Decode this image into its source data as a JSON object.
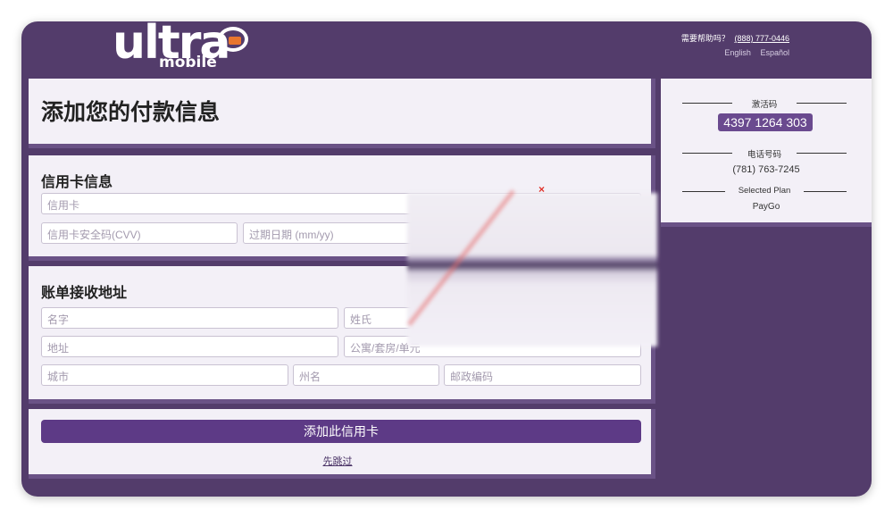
{
  "header": {
    "logo_word": "ultra",
    "logo_sub": "mobile",
    "help_label": "需要帮助吗？",
    "help_phone": "(888) 777-0446",
    "lang_en": "English",
    "lang_es": "Español"
  },
  "title_panel": {
    "title": "添加您的付款信息"
  },
  "card_panel": {
    "heading": "信用卡信息",
    "card_number_placeholder": "信用卡",
    "cvv_placeholder": "信用卡安全码(CVV)",
    "expiry_placeholder": "过期日期 (mm/yy)"
  },
  "address_panel": {
    "heading": "账单接收地址",
    "first_name_placeholder": "名字",
    "last_name_placeholder": "姓氏",
    "address_placeholder": "地址",
    "apt_placeholder": "公寓/套房/单元",
    "city_placeholder": "城市",
    "state_placeholder": "州名",
    "zip_placeholder": "邮政编码"
  },
  "actions": {
    "add_card_label": "添加此信用卡",
    "skip_label": "先跳过"
  },
  "sidebar": {
    "activation_label": "激活码",
    "activation_code": "4397 1264 303",
    "phone_label": "电话号码",
    "phone_number": "(781) 763-7245",
    "plan_label": "Selected Plan",
    "plan_value": "PayGo"
  },
  "marker": {
    "symbol": "×"
  },
  "colors": {
    "brand_purple": "#533c6b",
    "button_purple": "#5d3a86",
    "panel_bg": "#f3f0f7",
    "accent_orange": "#e8762d"
  }
}
